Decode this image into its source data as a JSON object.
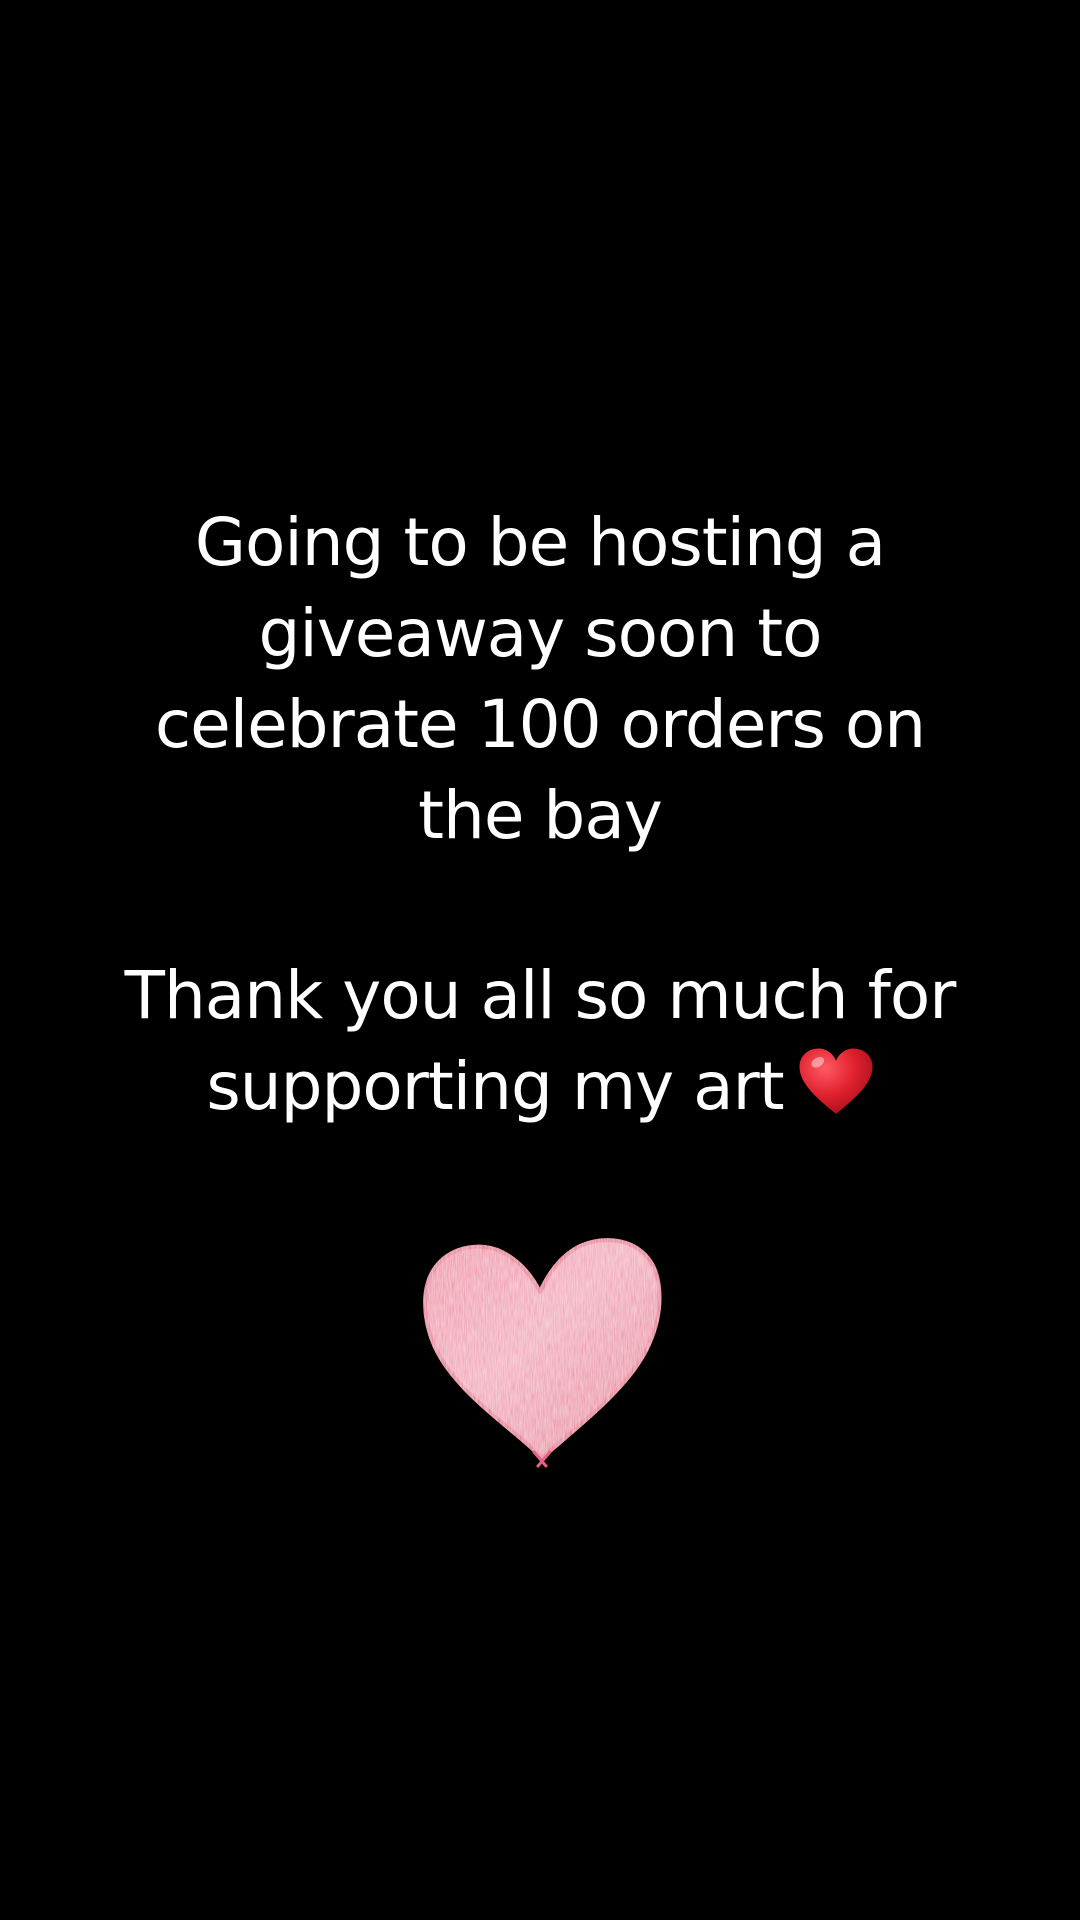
{
  "caption": {
    "announcement_lines": [
      "Going to be hosting a",
      "giveaway soon to",
      "celebrate 100 orders on",
      "the bay"
    ],
    "thanks_lines": [
      "Thank you all so much for",
      "supporting my art"
    ],
    "inline_emoji_icon": "red-heart-emoji-icon"
  },
  "sticker": {
    "icon": "pink-crayon-heart-icon",
    "color": "#ee7e97"
  },
  "colors": {
    "background": "#000000",
    "text": "#ffffff",
    "emoji_red": "#e0212e"
  }
}
